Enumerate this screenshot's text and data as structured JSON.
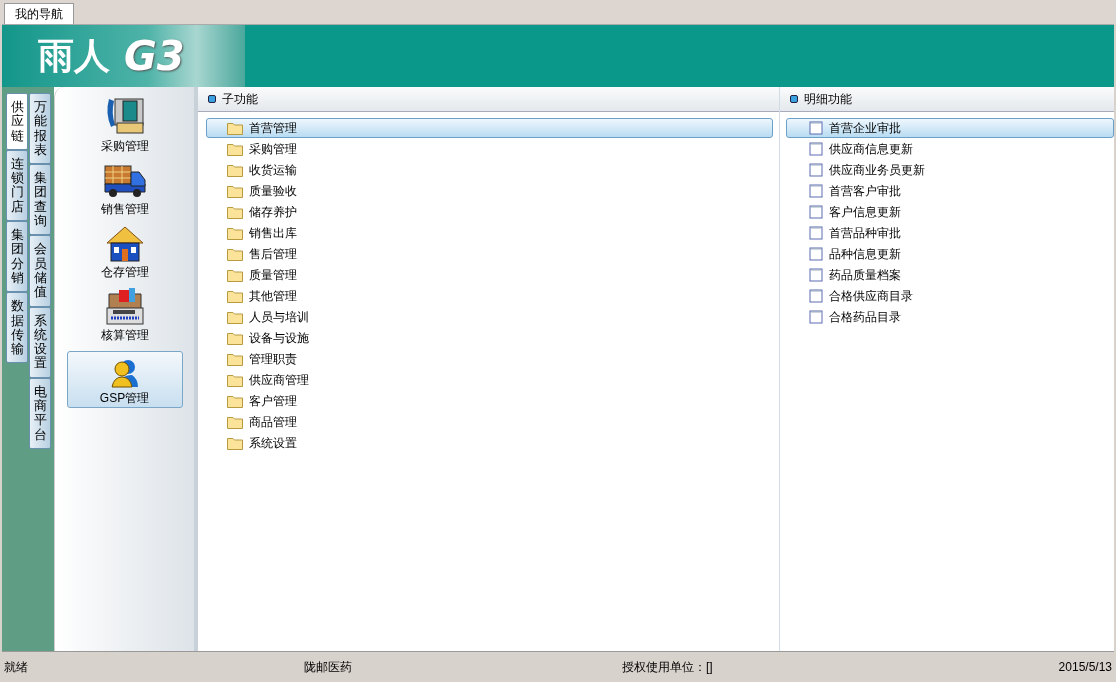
{
  "nav_tab": {
    "label": "我的导航",
    "selected": true
  },
  "logo": {
    "text": "雨人",
    "mark": "G3"
  },
  "outer_tabs": [
    {
      "label": "供应链",
      "selected": true
    },
    {
      "label": "连锁门店",
      "selected": false
    },
    {
      "label": "集团分销",
      "selected": false
    },
    {
      "label": "数据传输",
      "selected": false
    }
  ],
  "inner_tabs": [
    {
      "label": "万能报表",
      "selected": false
    },
    {
      "label": "集团查询",
      "selected": false
    },
    {
      "label": "会员储值",
      "selected": false
    },
    {
      "label": "系统设置",
      "selected": false
    },
    {
      "label": "电商平台",
      "selected": false
    }
  ],
  "modules": [
    {
      "label": "采购管理",
      "kind": "phone",
      "selected": false
    },
    {
      "label": "销售管理",
      "kind": "truck",
      "selected": false
    },
    {
      "label": "仓存管理",
      "kind": "house",
      "selected": false
    },
    {
      "label": "核算管理",
      "kind": "calculator",
      "selected": false
    },
    {
      "label": "GSP管理",
      "kind": "person",
      "selected": true
    }
  ],
  "sub_functions": {
    "title": "子功能",
    "items": [
      {
        "label": "首营管理",
        "selected": true
      },
      {
        "label": "采购管理",
        "selected": false
      },
      {
        "label": "收货运输",
        "selected": false
      },
      {
        "label": "质量验收",
        "selected": false
      },
      {
        "label": "储存养护",
        "selected": false
      },
      {
        "label": "销售出库",
        "selected": false
      },
      {
        "label": "售后管理",
        "selected": false
      },
      {
        "label": "质量管理",
        "selected": false
      },
      {
        "label": "其他管理",
        "selected": false
      },
      {
        "label": "人员与培训",
        "selected": false
      },
      {
        "label": "设备与设施",
        "selected": false
      },
      {
        "label": "管理职责",
        "selected": false
      },
      {
        "label": "供应商管理",
        "selected": false
      },
      {
        "label": "客户管理",
        "selected": false
      },
      {
        "label": "商品管理",
        "selected": false
      },
      {
        "label": "系统设置",
        "selected": false
      }
    ]
  },
  "detail_functions": {
    "title": "明细功能",
    "items": [
      {
        "label": "首营企业审批",
        "selected": true
      },
      {
        "label": "供应商信息更新",
        "selected": false
      },
      {
        "label": "供应商业务员更新",
        "selected": false
      },
      {
        "label": "首营客户审批",
        "selected": false
      },
      {
        "label": "客户信息更新",
        "selected": false
      },
      {
        "label": "首营品种审批",
        "selected": false
      },
      {
        "label": "品种信息更新",
        "selected": false
      },
      {
        "label": "药品质量档案",
        "selected": false
      },
      {
        "label": "合格供应商目录",
        "selected": false
      },
      {
        "label": "合格药品目录",
        "selected": false
      }
    ]
  },
  "status_bar": {
    "state": "就绪",
    "company": "陇邮医药",
    "license": "授权使用单位：[]",
    "date": "2015/5/13"
  }
}
